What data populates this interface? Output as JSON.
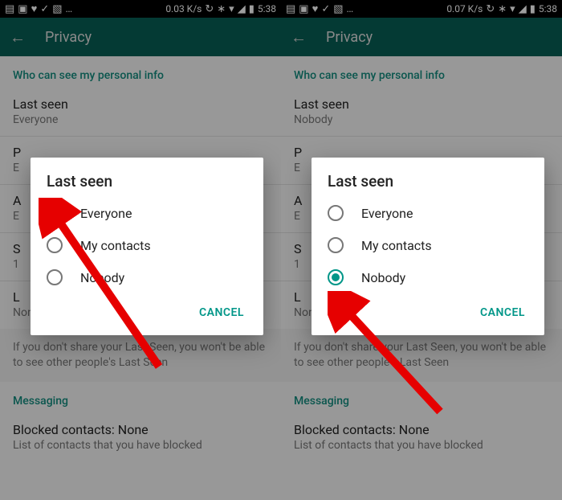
{
  "status": {
    "speed_left": "0.03 K/s",
    "speed_right": "0.07 K/s",
    "time": "5:38"
  },
  "appbar": {
    "title": "Privacy"
  },
  "sections": {
    "personal_info_header": "Who can see my personal info",
    "last_seen_label": "Last seen",
    "last_seen_value_left": "Everyone",
    "last_seen_value_right": "Nobody",
    "profile_label_initial": "P",
    "profile_value_initial": "E",
    "about_label_initial": "A",
    "about_value_initial": "E",
    "status_label_initial": "S",
    "status_value_initial": "1",
    "live_label_initial": "L",
    "live_value": "None",
    "disclaimer": "If you don't share your Last Seen, you won't be able to see other people's Last Seen",
    "messaging_header": "Messaging",
    "blocked_label": "Blocked contacts: None",
    "blocked_sub": "List of contacts that you have blocked"
  },
  "dialog": {
    "title": "Last seen",
    "options": [
      "Everyone",
      "My contacts",
      "Nobody"
    ],
    "cancel": "CANCEL",
    "selected_left": 0,
    "selected_right": 2
  }
}
